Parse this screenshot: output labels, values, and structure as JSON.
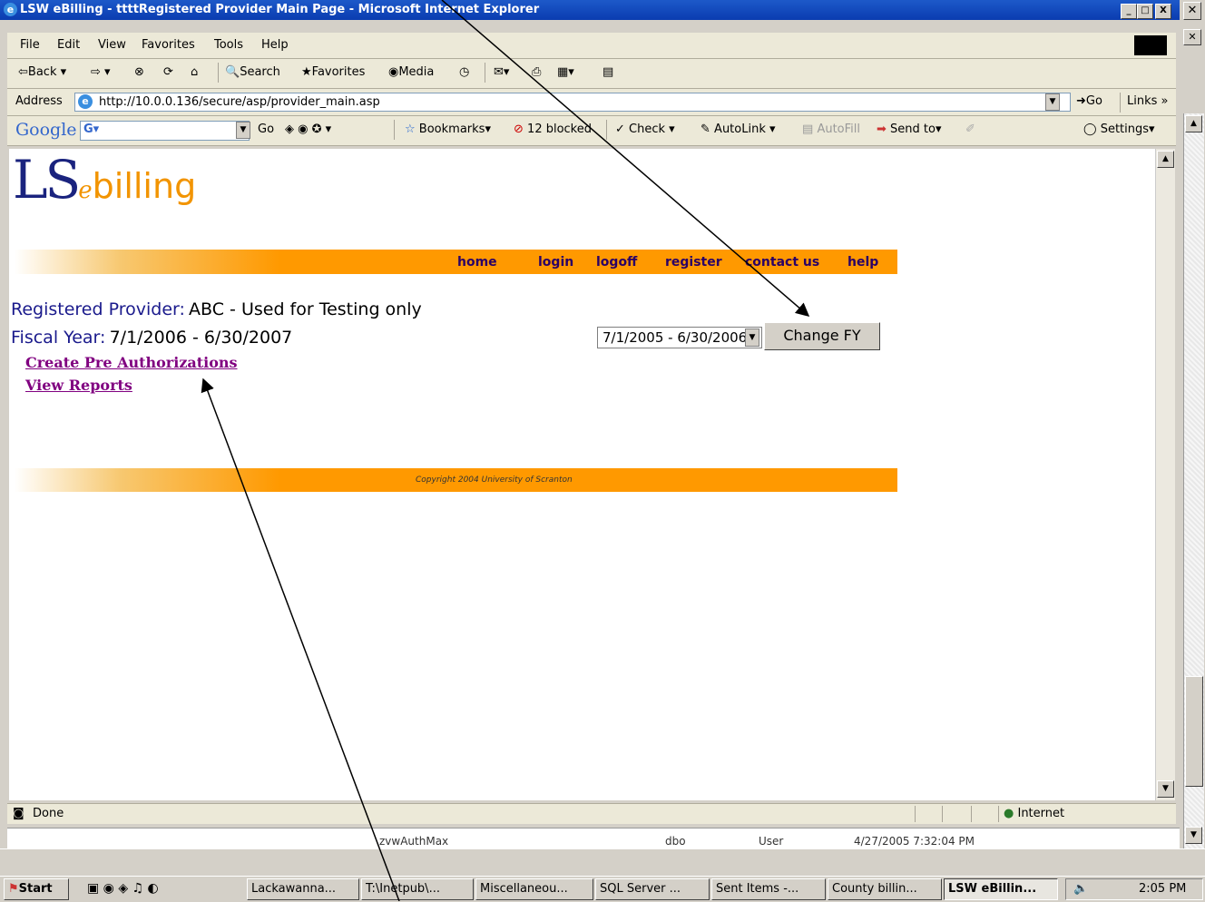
{
  "window": {
    "title": "LSW eBilling - ttttRegistered Provider Main Page - Microsoft Internet Explorer",
    "min": "_",
    "max": "□",
    "close": "X"
  },
  "menu": [
    "File",
    "Edit",
    "View",
    "Favorites",
    "Tools",
    "Help"
  ],
  "toolbar": {
    "back": "Back",
    "search": "Search",
    "favorites": "Favorites",
    "media": "Media"
  },
  "address": {
    "label": "Address",
    "url": "http://10.0.0.136/secure/asp/provider_main.asp",
    "go": "Go",
    "links": "Links"
  },
  "google_bar": {
    "logo": "Google",
    "go": "Go",
    "bookmarks": "Bookmarks",
    "blocked": "12 blocked",
    "check": "Check",
    "autolink": "AutoLink",
    "autofill": "AutoFill",
    "sendto": "Send to",
    "settings": "Settings"
  },
  "page": {
    "logo_ls": "LS",
    "logo_e": "e",
    "logo_billing": "billing",
    "nav": [
      "home",
      "login",
      "logoff",
      "register",
      "contact us",
      "help"
    ],
    "provider_label": "Registered Provider:",
    "provider_value": "ABC - Used for Testing only",
    "fy_label": "Fiscal Year:",
    "fy_value": "7/1/2006 - 6/30/2007",
    "fy_select": "7/1/2005 - 6/30/2006",
    "change_fy": "Change FY",
    "link_preauth": "Create Pre Authorizations",
    "link_reports": "View Reports",
    "copyright": "Copyright 2004  University of Scranton"
  },
  "status": {
    "text": "Done",
    "zone": "Internet"
  },
  "behind_window": {
    "name": "zvwAuthMax",
    "owner": "dbo",
    "type": "User",
    "date": "4/27/2005 7:32:04 PM"
  },
  "taskbar": {
    "start": "Start",
    "tasks": [
      "Lackawanna...",
      "T:\\Inetpub\\...",
      "Miscellaneou...",
      "SQL Server ...",
      "Sent Items -...",
      "County billin...",
      "LSW eBillin..."
    ],
    "clock": "2:05 PM"
  },
  "colors": {
    "orange": "#ff9900",
    "navy": "#1a237e",
    "link": "#800080"
  }
}
